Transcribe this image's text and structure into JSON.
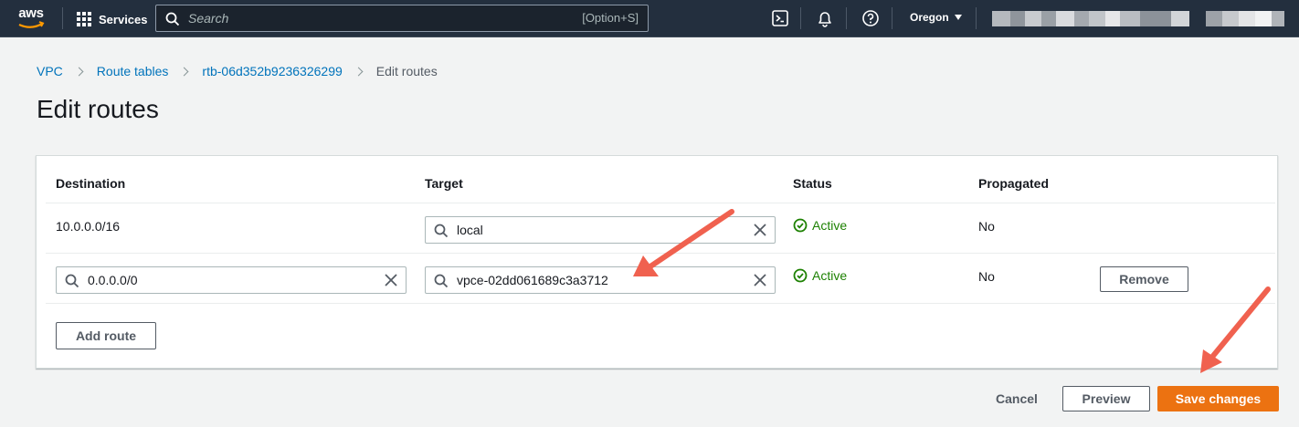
{
  "topnav": {
    "logo": "aws",
    "services_label": "Services",
    "search_placeholder": "Search",
    "search_shortcut": "[Option+S]",
    "region": "Oregon",
    "icons": [
      "cloudshell-icon",
      "bell-icon",
      "help-icon"
    ]
  },
  "breadcrumb": {
    "items": [
      "VPC",
      "Route tables",
      "rtb-06d352b9236326299"
    ],
    "current": "Edit routes"
  },
  "page": {
    "title": "Edit routes"
  },
  "table": {
    "headers": [
      "Destination",
      "Target",
      "Status",
      "Propagated"
    ],
    "rows": [
      {
        "destination": "10.0.0.0/16",
        "target": "local",
        "status": "Active",
        "propagated": "No"
      },
      {
        "destination": "0.0.0.0/0",
        "target": "vpce-02dd061689c3a3712",
        "status": "Active",
        "propagated": "No",
        "remove_label": "Remove"
      }
    ],
    "add_route_label": "Add route"
  },
  "footer": {
    "cancel_label": "Cancel",
    "preview_label": "Preview",
    "save_label": "Save changes"
  },
  "colors": {
    "nav_bg": "#232f3e",
    "link": "#0073bb",
    "status_active": "#1d8102",
    "primary": "#ec7211",
    "annotation_arrow": "#f0614f"
  }
}
